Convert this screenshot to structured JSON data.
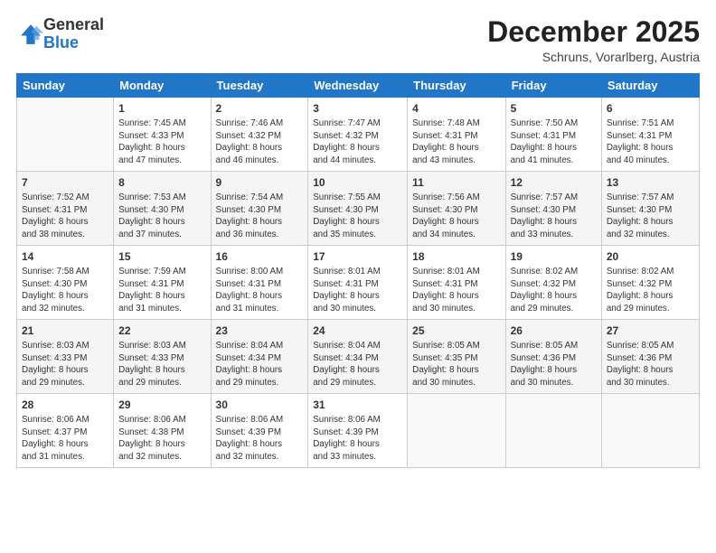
{
  "logo": {
    "general": "General",
    "blue": "Blue"
  },
  "header": {
    "month": "December 2025",
    "location": "Schruns, Vorarlberg, Austria"
  },
  "weekdays": [
    "Sunday",
    "Monday",
    "Tuesday",
    "Wednesday",
    "Thursday",
    "Friday",
    "Saturday"
  ],
  "weeks": [
    [
      {
        "day": "",
        "info": ""
      },
      {
        "day": "1",
        "info": "Sunrise: 7:45 AM\nSunset: 4:33 PM\nDaylight: 8 hours\nand 47 minutes."
      },
      {
        "day": "2",
        "info": "Sunrise: 7:46 AM\nSunset: 4:32 PM\nDaylight: 8 hours\nand 46 minutes."
      },
      {
        "day": "3",
        "info": "Sunrise: 7:47 AM\nSunset: 4:32 PM\nDaylight: 8 hours\nand 44 minutes."
      },
      {
        "day": "4",
        "info": "Sunrise: 7:48 AM\nSunset: 4:31 PM\nDaylight: 8 hours\nand 43 minutes."
      },
      {
        "day": "5",
        "info": "Sunrise: 7:50 AM\nSunset: 4:31 PM\nDaylight: 8 hours\nand 41 minutes."
      },
      {
        "day": "6",
        "info": "Sunrise: 7:51 AM\nSunset: 4:31 PM\nDaylight: 8 hours\nand 40 minutes."
      }
    ],
    [
      {
        "day": "7",
        "info": "Sunrise: 7:52 AM\nSunset: 4:31 PM\nDaylight: 8 hours\nand 38 minutes."
      },
      {
        "day": "8",
        "info": "Sunrise: 7:53 AM\nSunset: 4:30 PM\nDaylight: 8 hours\nand 37 minutes."
      },
      {
        "day": "9",
        "info": "Sunrise: 7:54 AM\nSunset: 4:30 PM\nDaylight: 8 hours\nand 36 minutes."
      },
      {
        "day": "10",
        "info": "Sunrise: 7:55 AM\nSunset: 4:30 PM\nDaylight: 8 hours\nand 35 minutes."
      },
      {
        "day": "11",
        "info": "Sunrise: 7:56 AM\nSunset: 4:30 PM\nDaylight: 8 hours\nand 34 minutes."
      },
      {
        "day": "12",
        "info": "Sunrise: 7:57 AM\nSunset: 4:30 PM\nDaylight: 8 hours\nand 33 minutes."
      },
      {
        "day": "13",
        "info": "Sunrise: 7:57 AM\nSunset: 4:30 PM\nDaylight: 8 hours\nand 32 minutes."
      }
    ],
    [
      {
        "day": "14",
        "info": "Sunrise: 7:58 AM\nSunset: 4:30 PM\nDaylight: 8 hours\nand 32 minutes."
      },
      {
        "day": "15",
        "info": "Sunrise: 7:59 AM\nSunset: 4:31 PM\nDaylight: 8 hours\nand 31 minutes."
      },
      {
        "day": "16",
        "info": "Sunrise: 8:00 AM\nSunset: 4:31 PM\nDaylight: 8 hours\nand 31 minutes."
      },
      {
        "day": "17",
        "info": "Sunrise: 8:01 AM\nSunset: 4:31 PM\nDaylight: 8 hours\nand 30 minutes."
      },
      {
        "day": "18",
        "info": "Sunrise: 8:01 AM\nSunset: 4:31 PM\nDaylight: 8 hours\nand 30 minutes."
      },
      {
        "day": "19",
        "info": "Sunrise: 8:02 AM\nSunset: 4:32 PM\nDaylight: 8 hours\nand 29 minutes."
      },
      {
        "day": "20",
        "info": "Sunrise: 8:02 AM\nSunset: 4:32 PM\nDaylight: 8 hours\nand 29 minutes."
      }
    ],
    [
      {
        "day": "21",
        "info": "Sunrise: 8:03 AM\nSunset: 4:33 PM\nDaylight: 8 hours\nand 29 minutes."
      },
      {
        "day": "22",
        "info": "Sunrise: 8:03 AM\nSunset: 4:33 PM\nDaylight: 8 hours\nand 29 minutes."
      },
      {
        "day": "23",
        "info": "Sunrise: 8:04 AM\nSunset: 4:34 PM\nDaylight: 8 hours\nand 29 minutes."
      },
      {
        "day": "24",
        "info": "Sunrise: 8:04 AM\nSunset: 4:34 PM\nDaylight: 8 hours\nand 29 minutes."
      },
      {
        "day": "25",
        "info": "Sunrise: 8:05 AM\nSunset: 4:35 PM\nDaylight: 8 hours\nand 30 minutes."
      },
      {
        "day": "26",
        "info": "Sunrise: 8:05 AM\nSunset: 4:36 PM\nDaylight: 8 hours\nand 30 minutes."
      },
      {
        "day": "27",
        "info": "Sunrise: 8:05 AM\nSunset: 4:36 PM\nDaylight: 8 hours\nand 30 minutes."
      }
    ],
    [
      {
        "day": "28",
        "info": "Sunrise: 8:06 AM\nSunset: 4:37 PM\nDaylight: 8 hours\nand 31 minutes."
      },
      {
        "day": "29",
        "info": "Sunrise: 8:06 AM\nSunset: 4:38 PM\nDaylight: 8 hours\nand 32 minutes."
      },
      {
        "day": "30",
        "info": "Sunrise: 8:06 AM\nSunset: 4:39 PM\nDaylight: 8 hours\nand 32 minutes."
      },
      {
        "day": "31",
        "info": "Sunrise: 8:06 AM\nSunset: 4:39 PM\nDaylight: 8 hours\nand 33 minutes."
      },
      {
        "day": "",
        "info": ""
      },
      {
        "day": "",
        "info": ""
      },
      {
        "day": "",
        "info": ""
      }
    ]
  ]
}
